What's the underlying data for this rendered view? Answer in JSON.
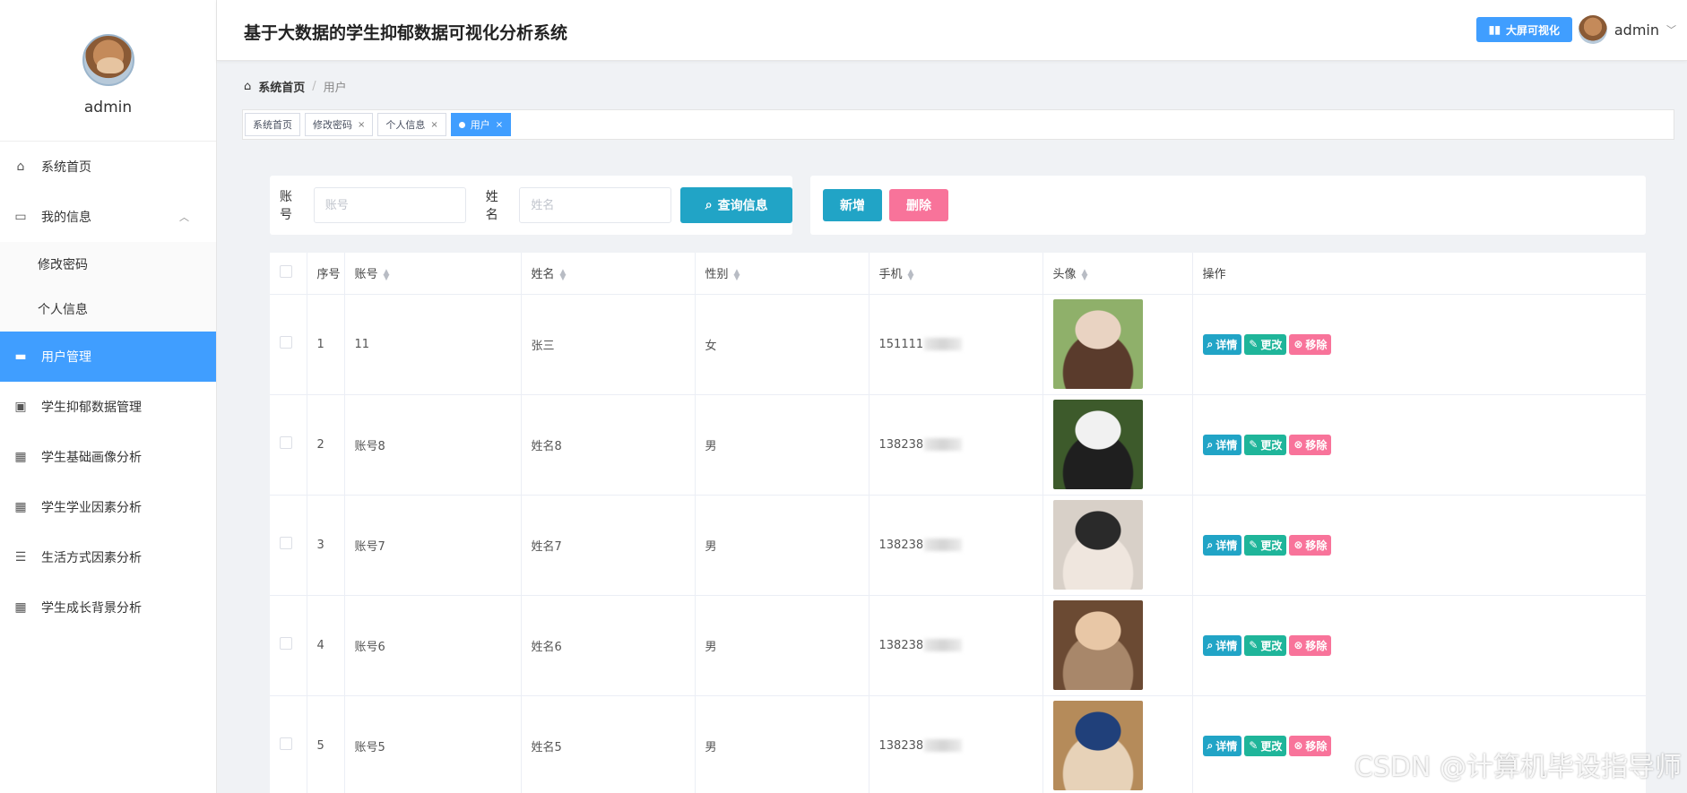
{
  "sidebar": {
    "username": "admin",
    "items": [
      {
        "label": "系统首页",
        "icon": "home-icon",
        "glyph": "⌂",
        "type": "top"
      },
      {
        "label": "我的信息",
        "icon": "card-icon",
        "glyph": "▭",
        "type": "top",
        "expanded": true
      },
      {
        "label": "修改密码",
        "type": "sub"
      },
      {
        "label": "个人信息",
        "type": "sub"
      },
      {
        "label": "用户管理",
        "icon": "ticket-icon",
        "glyph": "▬",
        "type": "top",
        "active": true
      },
      {
        "label": "学生抑郁数据管理",
        "icon": "clipboard-icon",
        "glyph": "▣",
        "type": "top"
      },
      {
        "label": "学生基础画像分析",
        "icon": "grid-icon",
        "glyph": "▦",
        "type": "top"
      },
      {
        "label": "学生学业因素分析",
        "icon": "grid-icon",
        "glyph": "▦",
        "type": "top"
      },
      {
        "label": "生活方式因素分析",
        "icon": "sliders-icon",
        "glyph": "☰",
        "type": "top"
      },
      {
        "label": "学生成长背景分析",
        "icon": "grid-icon",
        "glyph": "▦",
        "type": "top"
      }
    ]
  },
  "header": {
    "title": "基于大数据的学生抑郁数据可视化分析系统",
    "big_screen": "大屏可视化",
    "username": "admin"
  },
  "breadcrumb": {
    "home": "系统首页",
    "sep": "/",
    "current": "用户"
  },
  "tags": [
    {
      "label": "系统首页",
      "closable": false
    },
    {
      "label": "修改密码",
      "closable": true
    },
    {
      "label": "个人信息",
      "closable": true
    },
    {
      "label": "用户",
      "closable": true,
      "active": true
    }
  ],
  "search": {
    "account_label": "账号",
    "account_placeholder": "账号",
    "name_label": "姓名",
    "name_placeholder": "姓名",
    "query_btn": "查询信息"
  },
  "actions": {
    "add": "新增",
    "delete": "删除"
  },
  "table": {
    "columns": [
      "序号",
      "账号",
      "姓名",
      "性别",
      "手机",
      "头像",
      "操作"
    ],
    "rows": [
      {
        "no": "1",
        "account": "11",
        "name": "张三",
        "gender": "女",
        "phone": "151111",
        "photo_colors": [
          "#8fb06a",
          "#e9d3c2",
          "#5a3b2c"
        ]
      },
      {
        "no": "2",
        "account": "账号8",
        "name": "姓名8",
        "gender": "男",
        "phone": "138238",
        "photo_colors": [
          "#3d5a2b",
          "#f1f1f1",
          "#1f1f1f"
        ]
      },
      {
        "no": "3",
        "account": "账号7",
        "name": "姓名7",
        "gender": "男",
        "phone": "138238",
        "photo_colors": [
          "#d8d0c8",
          "#2a2a2a",
          "#efe6de"
        ]
      },
      {
        "no": "4",
        "account": "账号6",
        "name": "姓名6",
        "gender": "男",
        "phone": "138238",
        "photo_colors": [
          "#6b4a33",
          "#e8c7a6",
          "#a8876a"
        ]
      },
      {
        "no": "5",
        "account": "账号5",
        "name": "姓名5",
        "gender": "男",
        "phone": "138238",
        "photo_colors": [
          "#b58b5a",
          "#20407a",
          "#e7d2b8"
        ]
      }
    ],
    "ops": {
      "detail": "详情",
      "edit": "更改",
      "remove": "移除"
    }
  },
  "watermark": "CSDN @计算机毕设指导师"
}
